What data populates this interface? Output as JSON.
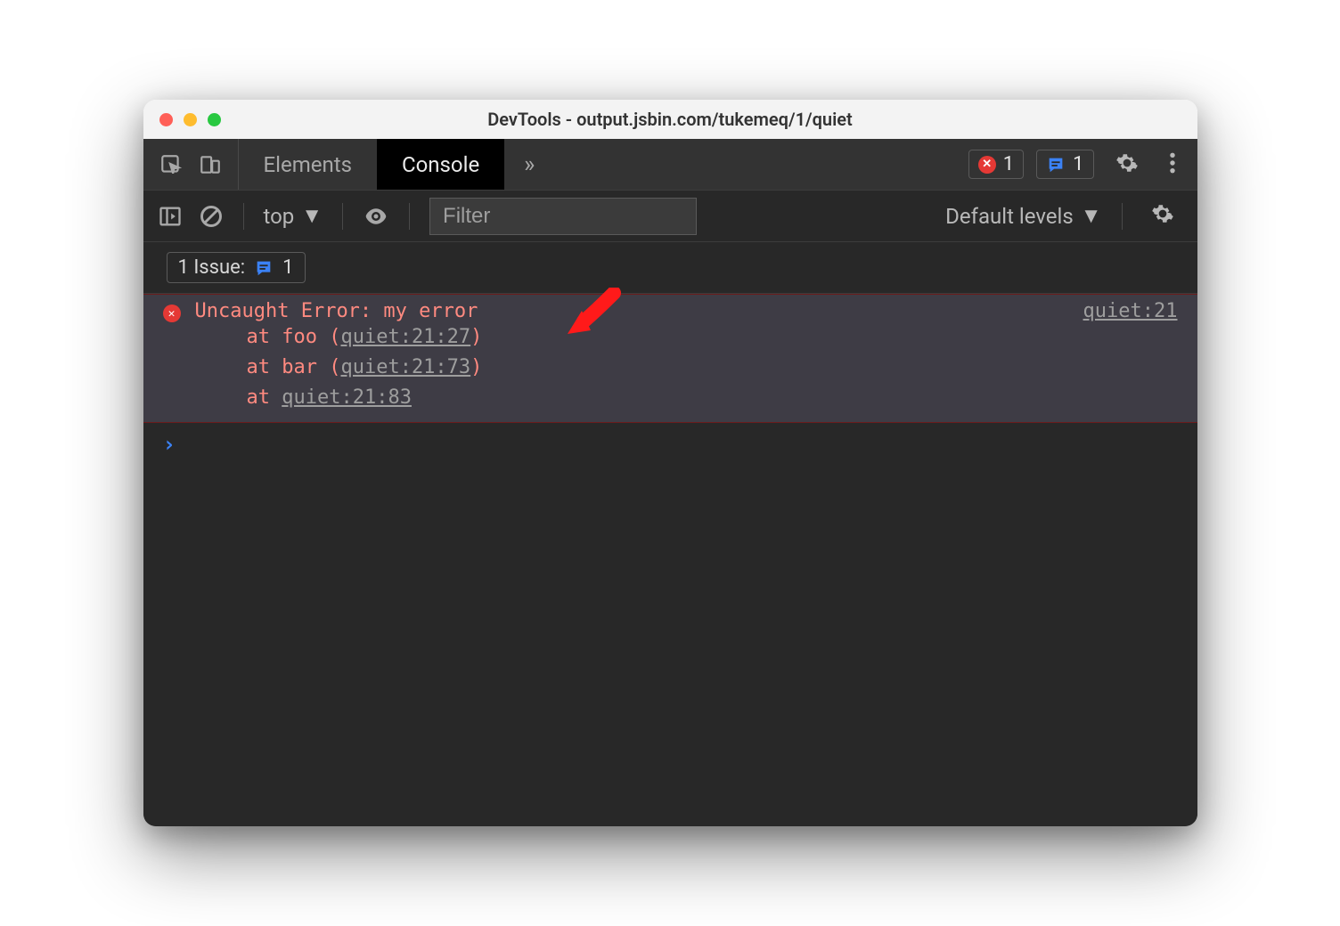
{
  "window": {
    "title": "DevTools - output.jsbin.com/tukemeq/1/quiet"
  },
  "tabs": {
    "elements": "Elements",
    "console": "Console",
    "overflow": "»"
  },
  "badges": {
    "error_count": "1",
    "issue_count": "1"
  },
  "toolbar": {
    "context": "top",
    "filter_placeholder": "Filter",
    "levels": "Default levels"
  },
  "issues": {
    "label": "1 Issue:",
    "count": "1"
  },
  "error": {
    "message": "Uncaught Error: my error",
    "source_link": "quiet:21",
    "stack": [
      {
        "prefix": "at foo (",
        "link": "quiet:21:27",
        "suffix": ")"
      },
      {
        "prefix": "at bar (",
        "link": "quiet:21:73",
        "suffix": ")"
      },
      {
        "prefix": "at ",
        "link": "quiet:21:83",
        "suffix": ""
      }
    ]
  },
  "prompt": "›"
}
